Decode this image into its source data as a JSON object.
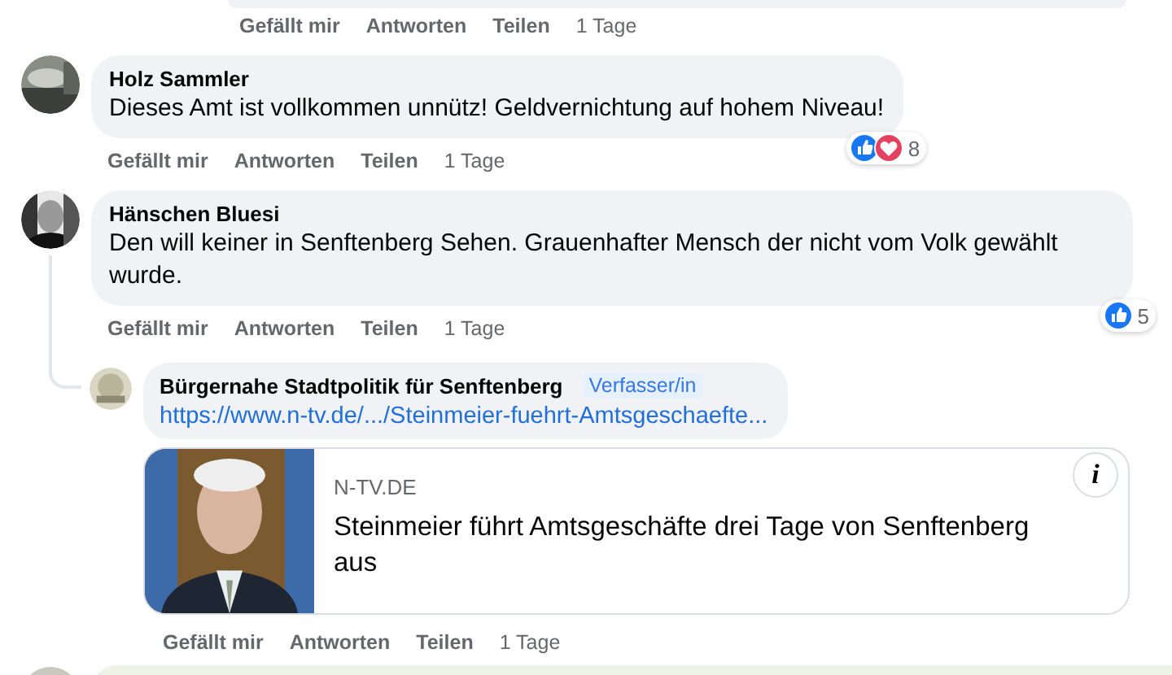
{
  "top_actions": {
    "like": "Gefällt mir",
    "reply": "Antworten",
    "share": "Teilen",
    "time": "1 Tage"
  },
  "comments": [
    {
      "author": "Holz Sammler",
      "text": "Dieses Amt ist vollkommen unnütz! Geldvernichtung auf hohem Niveau!",
      "reactions": [
        {
          "kind": "like"
        },
        {
          "kind": "love"
        }
      ],
      "reaction_count": "8",
      "actions": {
        "like": "Gefällt mir",
        "reply": "Antworten",
        "share": "Teilen",
        "time": "1 Tage"
      }
    },
    {
      "author": "Hänschen Bluesi",
      "text": "Den will keiner in Senftenberg Sehen. Grauenhafter Mensch der nicht vom Volk gewählt wurde.",
      "reactions": [
        {
          "kind": "like"
        }
      ],
      "reaction_count": "5",
      "actions": {
        "like": "Gefällt mir",
        "reply": "Antworten",
        "share": "Teilen",
        "time": "1 Tage"
      },
      "replies": [
        {
          "author": "Bürgernahe Stadtpolitik für Senftenberg",
          "badge": "Verfasser/in",
          "link": "https://www.n-tv.de/.../Steinmeier-fuehrt-Amtsgeschaefte...",
          "preview": {
            "source": "N-TV.DE",
            "title": "Steinmeier führt Amtsgeschäfte drei Tage von Senftenberg aus",
            "info": "i"
          },
          "actions": {
            "like": "Gefällt mir",
            "reply": "Antworten",
            "share": "Teilen",
            "time": "1 Tage"
          }
        }
      ]
    }
  ]
}
